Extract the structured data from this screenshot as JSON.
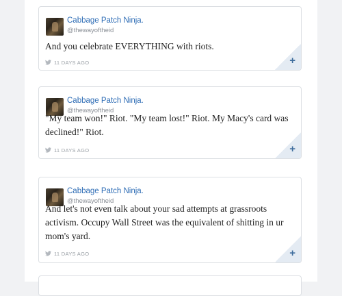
{
  "tweets": [
    {
      "author_name": "Cabbage Patch Ninja.",
      "author_handle": "@thewayoftheid",
      "text": "And you celebrate EVERYTHING with riots.",
      "timestamp": "11 DAYS AGO",
      "action_icon": "plus-icon",
      "action_symbol": "+"
    },
    {
      "author_name": "Cabbage Patch Ninja.",
      "author_handle": "@thewayoftheid",
      "text": "\"My team won!\" Riot. \"My team lost!\" Riot. My Macy's card was declined!\" Riot.",
      "timestamp": "11 DAYS AGO",
      "action_icon": "plus-icon",
      "action_symbol": "+"
    },
    {
      "author_name": "Cabbage Patch Ninja.",
      "author_handle": "@thewayoftheid",
      "text": "And let's not even talk about your sad attempts at grassroots activism. Occupy Wall Street was the equivalent of shitting in ur mom's yard.",
      "timestamp": "11 DAYS AGO",
      "action_icon": "plus-icon",
      "action_symbol": "+"
    }
  ],
  "colors": {
    "name_link": "#2d6cb5",
    "handle": "#8a8f96",
    "meta": "#9aa0a6",
    "plus": "#3d6c9c",
    "background": "#f1f2f4"
  }
}
